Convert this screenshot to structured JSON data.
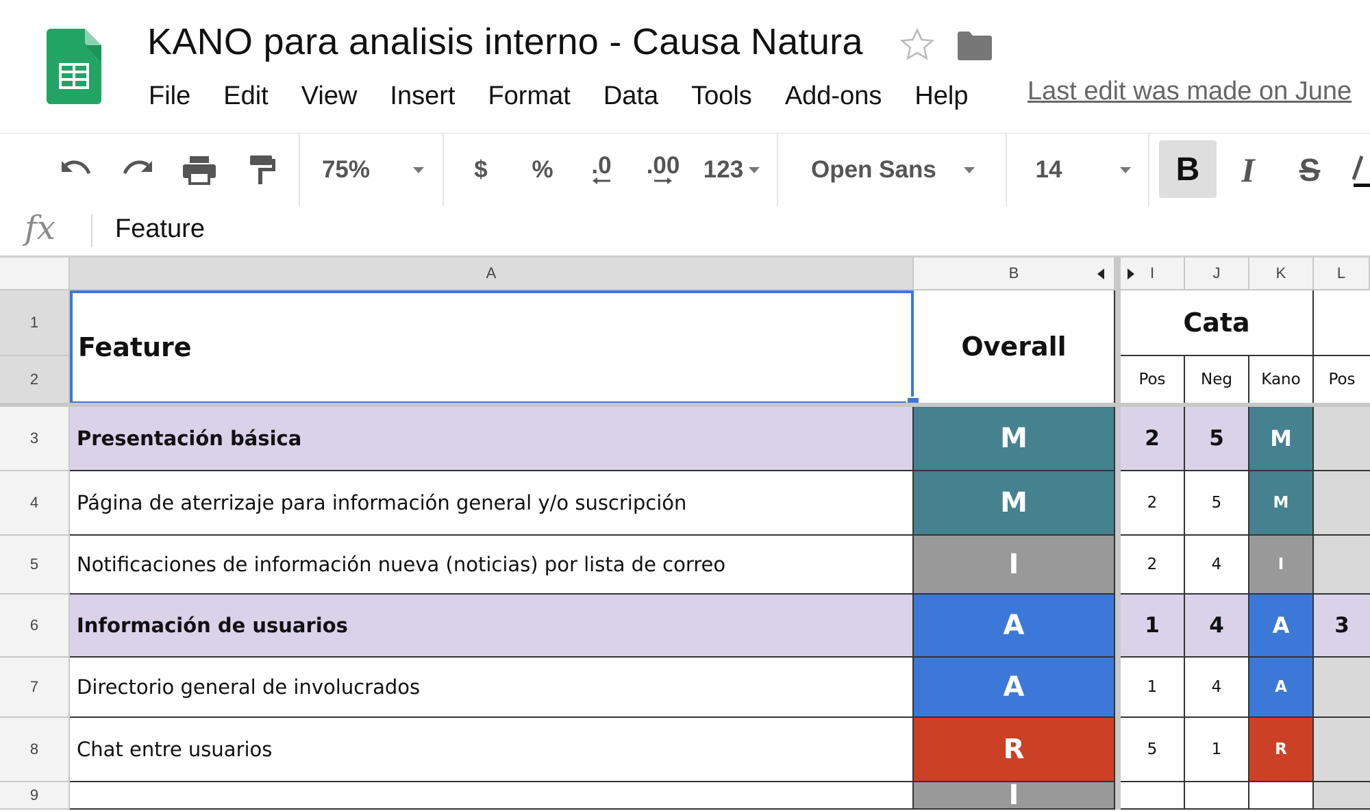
{
  "document": {
    "title": "KANO para analisis interno - Causa Natura",
    "last_edit": "Last edit was made on June"
  },
  "menu": [
    "File",
    "Edit",
    "View",
    "Insert",
    "Format",
    "Data",
    "Tools",
    "Add-ons",
    "Help"
  ],
  "toolbar": {
    "zoom": "75%",
    "currency": "$",
    "percent": "%",
    "decrease_decimal": ".0",
    "increase_decimal": ".00",
    "number_format": "123",
    "font": "Open Sans",
    "font_size": "14",
    "bold": "B",
    "italic": "I",
    "strikethrough": "S"
  },
  "formula_bar": {
    "fx": "fx",
    "value": "Feature"
  },
  "columns": [
    "A",
    "B",
    "I",
    "J",
    "K",
    "L"
  ],
  "header": {
    "feature": "Feature",
    "overall": "Overall",
    "group": "Cata",
    "sub": [
      "Pos",
      "Neg",
      "Kano",
      "Pos"
    ]
  },
  "kano_colors": {
    "M": "#45818e",
    "I": "#999999",
    "A": "#3c78d8",
    "R": "#cc4125"
  },
  "rows": [
    {
      "num": "1"
    },
    {
      "num": "2"
    },
    {
      "num": "3",
      "feature": "Presentación básica",
      "overall": "M",
      "pos": "2",
      "neg": "5",
      "kano": "M",
      "l_pos": "",
      "group": true
    },
    {
      "num": "4",
      "feature": "Página de aterrizaje para información general y/o suscripción",
      "overall": "M",
      "pos": "2",
      "neg": "5",
      "kano": "M",
      "l_pos": "",
      "group": false
    },
    {
      "num": "5",
      "feature": "Notificaciones de información nueva (noticias) por lista de correo",
      "overall": "I",
      "pos": "2",
      "neg": "4",
      "kano": "I",
      "l_pos": "",
      "group": false
    },
    {
      "num": "6",
      "feature": "Información de usuarios",
      "overall": "A",
      "pos": "1",
      "neg": "4",
      "kano": "A",
      "l_pos": "3",
      "group": true
    },
    {
      "num": "7",
      "feature": "Directorio general de involucrados",
      "overall": "A",
      "pos": "1",
      "neg": "4",
      "kano": "A",
      "l_pos": "",
      "group": false
    },
    {
      "num": "8",
      "feature": "Chat entre usuarios",
      "overall": "R",
      "pos": "5",
      "neg": "1",
      "kano": "R",
      "l_pos": "",
      "group": false
    },
    {
      "num": "9",
      "feature": "",
      "overall": "I",
      "pos": "",
      "neg": "",
      "kano": "",
      "l_pos": "",
      "group": false
    }
  ]
}
